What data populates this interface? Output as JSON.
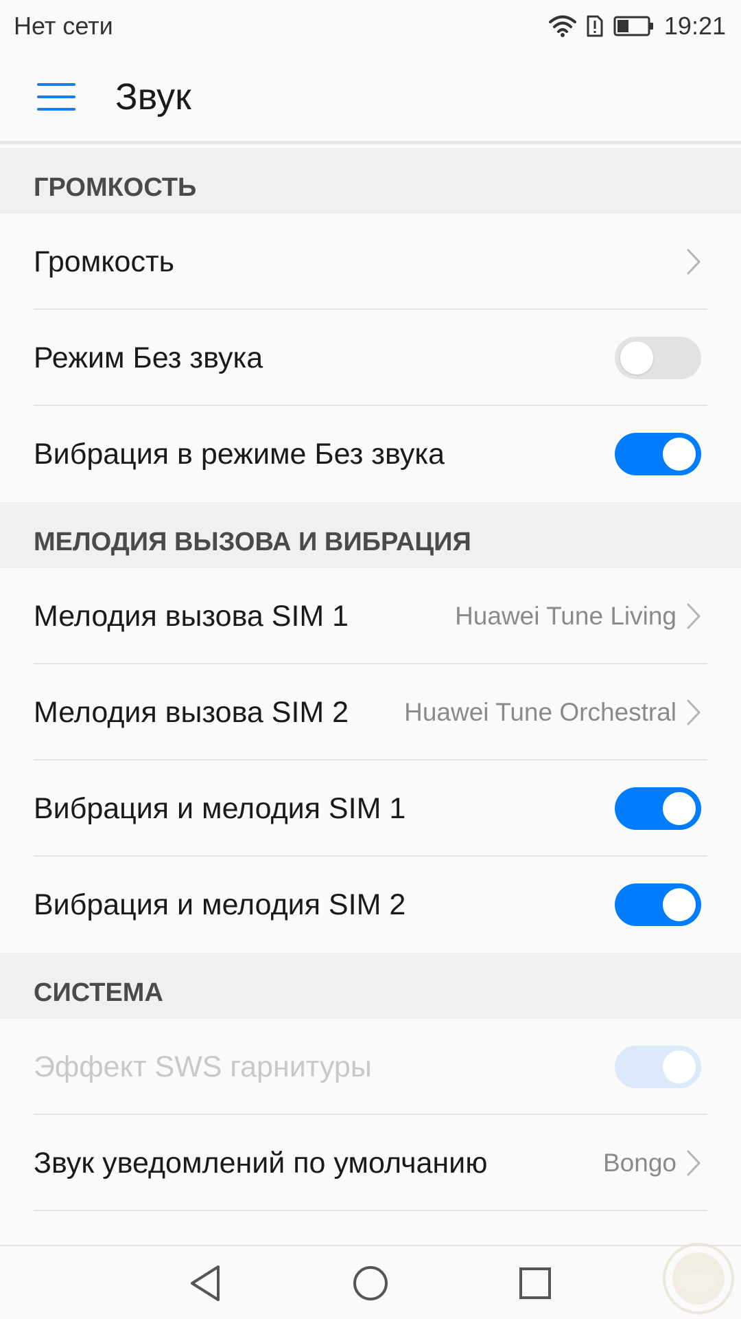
{
  "status_bar": {
    "carrier": "Нет сети",
    "time": "19:21",
    "icons": [
      "wifi-icon",
      "sim-alert-icon",
      "battery-icon"
    ]
  },
  "app_bar": {
    "menu_icon": "hamburger-menu-icon",
    "title": "Звук"
  },
  "colors": {
    "accent": "#007dff",
    "menu_icon": "#1a7ee8",
    "section_bg": "#f0f0f0",
    "toggle_off": "#e2e2e2",
    "toggle_disabled_on": "#dbe9fb"
  },
  "sections": {
    "volume": {
      "header": "ГРОМКОСТЬ",
      "items": [
        {
          "label": "Громкость",
          "control": "chevron"
        },
        {
          "label": "Режим Без звука",
          "control": "toggle",
          "on": false
        },
        {
          "label": "Вибрация в режиме Без звука",
          "control": "toggle",
          "on": true
        }
      ]
    },
    "ringtone": {
      "header": "МЕЛОДИЯ ВЫЗОВА И ВИБРАЦИЯ",
      "items": [
        {
          "label": "Мелодия вызова SIM 1",
          "value": "Huawei Tune Living",
          "control": "chevron"
        },
        {
          "label": "Мелодия вызова SIM 2",
          "value": "Huawei Tune Orchestral",
          "control": "chevron"
        },
        {
          "label": "Вибрация и мелодия SIM 1",
          "control": "toggle",
          "on": true
        },
        {
          "label": "Вибрация и мелодия SIM 2",
          "control": "toggle",
          "on": true
        }
      ]
    },
    "system": {
      "header": "СИСТЕМА",
      "items": [
        {
          "label": "Эффект SWS гарнитуры",
          "control": "toggle",
          "on": true,
          "disabled": true
        },
        {
          "label": "Звук уведомлений по умолчанию",
          "value": "Bongo",
          "control": "chevron"
        }
      ]
    }
  },
  "nav_bar": {
    "icons": [
      "back-triangle-icon",
      "home-circle-icon",
      "recent-apps-square-icon"
    ]
  }
}
